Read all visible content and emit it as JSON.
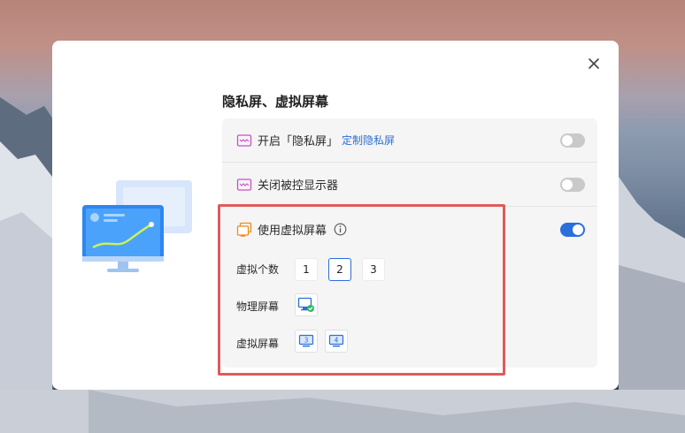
{
  "dialog": {
    "section_title": "隐私屏、虚拟屏幕",
    "privacy_screen": {
      "label": "开启「隐私屏」",
      "link": "定制隐私屏",
      "enabled": false
    },
    "close_monitor": {
      "label": "关闭被控显示器",
      "enabled": false
    },
    "virtual_screen": {
      "label": "使用虚拟屏幕",
      "enabled": true,
      "count_label": "虚拟个数",
      "count_options": [
        "1",
        "2",
        "3"
      ],
      "count_selected": "2",
      "physical_label": "物理屏幕",
      "virtual_label": "虚拟屏幕",
      "virtual_screens": [
        "3",
        "4"
      ]
    }
  },
  "colors": {
    "accent": "#2a6fdb",
    "link": "#2c6fd2",
    "highlight": "#e05a5a"
  }
}
